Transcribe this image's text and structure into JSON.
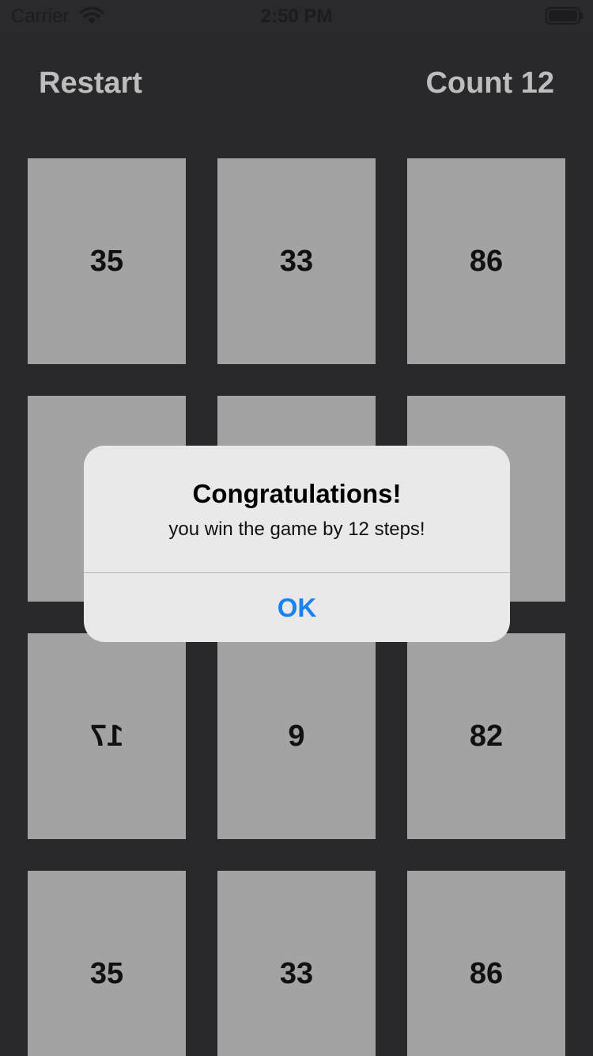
{
  "status_bar": {
    "carrier": "Carrier",
    "time": "2:50 PM",
    "wifi_icon": "wifi-icon",
    "battery_icon": "battery-icon"
  },
  "header": {
    "restart_label": "Restart",
    "count_label": "Count 12"
  },
  "cards": [
    {
      "value": "35"
    },
    {
      "value": "33"
    },
    {
      "value": "86"
    },
    {
      "value": ""
    },
    {
      "value": ""
    },
    {
      "value": ""
    },
    {
      "value": "17",
      "mirrored": true
    },
    {
      "value": "9"
    },
    {
      "value": "82"
    },
    {
      "value": "35"
    },
    {
      "value": "33"
    },
    {
      "value": "86"
    }
  ],
  "alert": {
    "title": "Congratulations!",
    "message": "you win the game by 12 steps!",
    "ok_label": "OK"
  },
  "colors": {
    "background": "#29292c",
    "card": "#a3a3a3",
    "header_text": "#bdbdbd",
    "alert_background": "#e9e9ea",
    "accent": "#1a82f0"
  }
}
